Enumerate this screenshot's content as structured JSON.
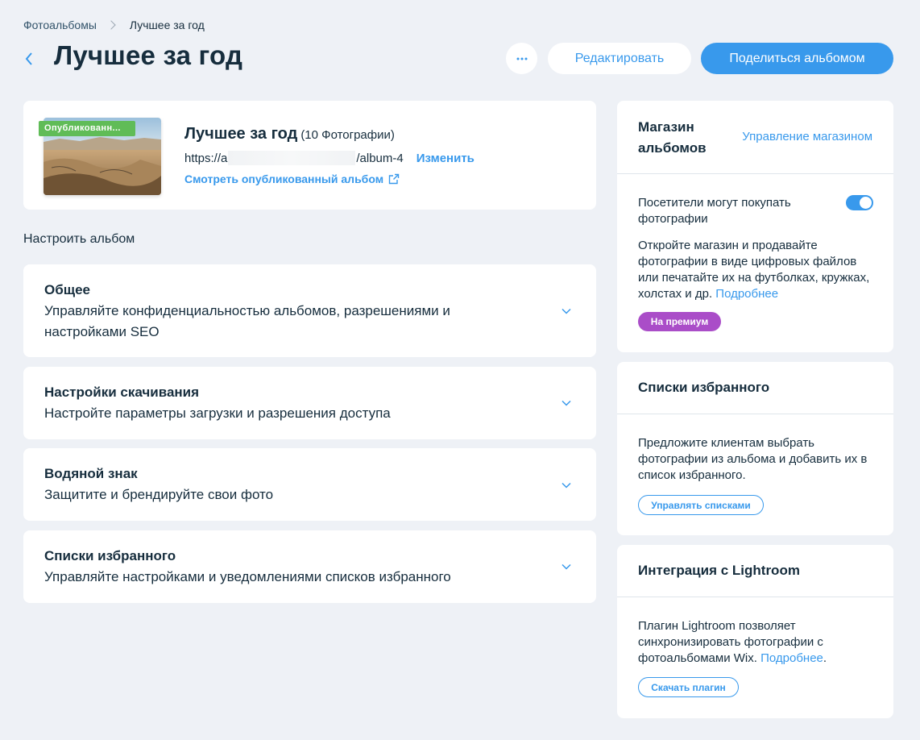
{
  "breadcrumb": {
    "parent": "Фотоальбомы",
    "current": "Лучшее за год"
  },
  "header": {
    "title": "Лучшее за год",
    "edit_label": "Редактировать",
    "share_label": "Поделиться альбомом"
  },
  "album": {
    "badge": "Опубликованн...",
    "name": "Лучшее за год",
    "count": "(10 Фотографии)",
    "url_prefix": "https://a",
    "url_suffix": "/album-4",
    "change_label": "Изменить",
    "view_label": "Смотреть опубликованный альбом"
  },
  "settings": {
    "section_label": "Настроить альбом",
    "items": [
      {
        "title": "Общее",
        "description": "Управляйте конфиденциальностью альбомов, разрешениями и настройками SEO"
      },
      {
        "title": "Настройки скачивания",
        "description": "Настройте параметры загрузки и разрешения доступа"
      },
      {
        "title": "Водяной знак",
        "description": "Защитите и брендируйте свои фото"
      },
      {
        "title": "Списки избранного",
        "description": "Управляйте настройками и уведомлениями списков избранного"
      }
    ]
  },
  "store": {
    "title": "Магазин альбомов",
    "manage_label": "Управление магазином",
    "toggle_label": "Посетители могут покупать фотографии",
    "toggle_on": true,
    "description": "Откройте магазин и продавайте фотографии в виде цифровых файлов или печатайте их на футболках, кружках, холстах и др.",
    "more_link": "Подробнее",
    "premium_label": "На премиум"
  },
  "favorites": {
    "title": "Списки избранного",
    "description": "Предложите клиентам выбрать фотографии из альбома и добавить их в список избранного.",
    "button_label": "Управлять списками"
  },
  "lightroom": {
    "title": "Интеграция с Lightroom",
    "description": "Плагин Lightroom позволяет синхронизировать фотографии с фотоальбомами Wix.",
    "more_link": "Подробнее",
    "period": ".",
    "button_label": "Скачать плагин"
  },
  "colors": {
    "accent": "#3899ec",
    "published": "#60bc57",
    "premium": "#aa4dc8",
    "background": "#eef1f6"
  }
}
